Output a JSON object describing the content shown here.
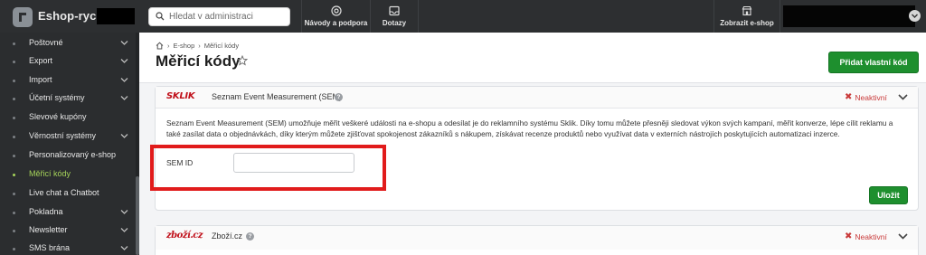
{
  "topbar": {
    "brand": "Eshop-rychle",
    "search_placeholder": "Hledat v administraci",
    "buttons": [
      {
        "label": "Návody a podpora",
        "icon": "lifebuoy-icon"
      },
      {
        "label": "Dotazy",
        "icon": "inbox-icon"
      },
      {
        "label": "Zobrazit e-shop",
        "icon": "storefront-icon"
      }
    ]
  },
  "sidebar": {
    "items": [
      {
        "label": "Poštovné",
        "has_children": true,
        "active": false
      },
      {
        "label": "Export",
        "has_children": true,
        "active": false
      },
      {
        "label": "Import",
        "has_children": true,
        "active": false
      },
      {
        "label": "Účetní systémy",
        "has_children": true,
        "active": false
      },
      {
        "label": "Slevové kupóny",
        "has_children": false,
        "active": false
      },
      {
        "label": "Věrnostní systémy",
        "has_children": true,
        "active": false
      },
      {
        "label": "Personalizovaný e-shop",
        "has_children": false,
        "active": false
      },
      {
        "label": "Měřicí kódy",
        "has_children": false,
        "active": true
      },
      {
        "label": "Live chat a Chatbot",
        "has_children": false,
        "active": false
      },
      {
        "label": "Pokladna",
        "has_children": true,
        "active": false
      },
      {
        "label": "Newsletter",
        "has_children": true,
        "active": false
      },
      {
        "label": "SMS brána",
        "has_children": true,
        "active": false
      }
    ]
  },
  "breadcrumb": {
    "home_icon": "home-icon",
    "items": [
      "E-shop",
      "Měřicí kódy"
    ]
  },
  "page": {
    "title": "Měřicí kódy",
    "add_button": "Přidat vlastní kód"
  },
  "cards": [
    {
      "logo": "SKLIK",
      "name": "Seznam Event Measurement (SEM)",
      "status": "Neaktivní",
      "description": "Seznam Event Measurement (SEM) umožňuje měřit veškeré události na e-shopu a odesílat je do reklamního systému Sklik. Díky tomu můžete přesněji sledovat výkon svých kampaní, měřit konverze, lépe cílit reklamu a také zasílat data o objednávkách, díky kterým můžete zjišťovat spokojenost zákazníků s nákupem, získávat recenze produktů nebo využívat data v externích nástrojích poskytujících automatizaci inzerce.",
      "field_label": "SEM ID",
      "field_value": "",
      "save_label": "Uložit"
    },
    {
      "logo": "zboží.cz",
      "name": "Zboží.cz",
      "status": "Neaktivní"
    }
  ],
  "colors": {
    "accent_green": "#1e8f2e",
    "active_nav": "#a6d35a",
    "inactive_red": "#c93a3a",
    "highlight_red": "#e11b1b"
  }
}
